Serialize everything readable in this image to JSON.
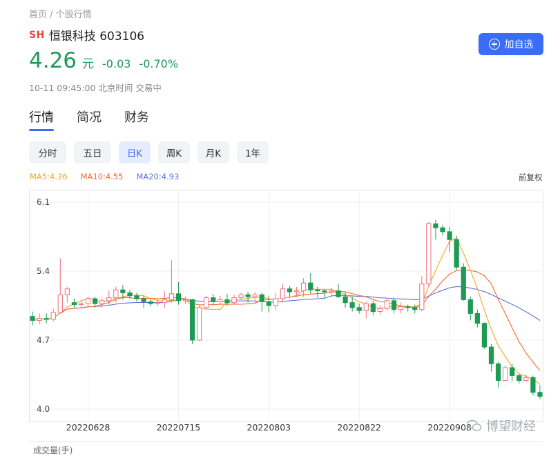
{
  "breadcrumb": {
    "home": "首页",
    "separator": "/",
    "current": "个股行情"
  },
  "stock": {
    "exchange": "SH",
    "name_code": "恒银科技 603106",
    "price": "4.26",
    "unit": "元",
    "change": "-0.03",
    "change_pct": "-0.70%",
    "time_status": "10-11 09:45:00 北京时间 交易中"
  },
  "follow_button": {
    "label": "加自选"
  },
  "tabs": [
    {
      "label": "行情"
    },
    {
      "label": "简况"
    },
    {
      "label": "财务"
    }
  ],
  "periods": [
    {
      "label": "分时"
    },
    {
      "label": "五日"
    },
    {
      "label": "日K"
    },
    {
      "label": "周K"
    },
    {
      "label": "月K"
    },
    {
      "label": "1年"
    }
  ],
  "ma_legend": {
    "ma5": "MA5:4.36",
    "ma10": "MA10:4.55",
    "ma20": "MA20:4.93"
  },
  "adjust_label": "前复权",
  "volume_label": "成交量(手)",
  "watermark": "博望财经",
  "colors": {
    "up": "#f26d7d",
    "down": "#1e9a52",
    "ma5": "#f5a623",
    "ma10": "#f06a2e",
    "ma20": "#5b72d8",
    "accent": "#3b6cf6"
  },
  "chart_data": {
    "type": "candlestick",
    "y_ticks": [
      "6.1",
      "5.4",
      "4.7",
      "4.0"
    ],
    "ylim": [
      4.0,
      6.1
    ],
    "x_labels": [
      "20220628",
      "20220715",
      "20220803",
      "20220822",
      "20220908"
    ],
    "ohlc": [
      [
        4.94,
        4.9,
        4.99,
        4.85
      ],
      [
        4.9,
        4.92,
        4.97,
        4.86
      ],
      [
        4.92,
        4.91,
        4.97,
        4.87
      ],
      [
        4.91,
        4.98,
        5.02,
        4.89
      ],
      [
        4.98,
        5.16,
        5.53,
        4.97
      ],
      [
        5.16,
        5.22,
        5.24,
        5.08
      ],
      [
        5.08,
        5.06,
        5.12,
        5.03
      ],
      [
        5.06,
        5.07,
        5.11,
        5.03
      ],
      [
        5.07,
        5.12,
        5.14,
        5.05
      ],
      [
        5.12,
        5.07,
        5.14,
        5.03
      ],
      [
        5.07,
        5.1,
        5.13,
        5.03
      ],
      [
        5.1,
        5.13,
        5.2,
        5.05
      ],
      [
        5.13,
        5.21,
        5.24,
        5.08
      ],
      [
        5.21,
        5.18,
        5.26,
        5.11
      ],
      [
        5.18,
        5.15,
        5.21,
        5.12
      ],
      [
        5.15,
        5.12,
        5.18,
        5.09
      ],
      [
        5.12,
        5.09,
        5.15,
        5.03
      ],
      [
        5.09,
        5.07,
        5.12,
        5.04
      ],
      [
        5.07,
        5.08,
        5.12,
        5.05
      ],
      [
        5.08,
        5.11,
        5.2,
        5.03
      ],
      [
        5.11,
        5.17,
        5.51,
        5.08
      ],
      [
        5.17,
        5.1,
        5.29,
        5.06
      ],
      [
        5.1,
        5.11,
        5.14,
        5.07
      ],
      [
        5.11,
        4.7,
        5.12,
        4.66
      ],
      [
        4.7,
        5.03,
        5.06,
        4.69
      ],
      [
        5.03,
        5.13,
        5.15,
        5.01
      ],
      [
        5.13,
        5.09,
        5.17,
        5.06
      ],
      [
        5.09,
        5.11,
        5.15,
        5.06
      ],
      [
        5.11,
        5.08,
        5.17,
        5.05
      ],
      [
        5.08,
        5.13,
        5.16,
        5.07
      ],
      [
        5.13,
        5.16,
        5.18,
        5.11
      ],
      [
        5.16,
        5.14,
        5.19,
        5.08
      ],
      [
        5.14,
        5.16,
        5.19,
        5.08
      ],
      [
        5.16,
        5.09,
        5.18,
        4.99
      ],
      [
        5.09,
        5.05,
        5.15,
        4.98
      ],
      [
        5.05,
        5.12,
        5.18,
        5.0
      ],
      [
        5.12,
        5.22,
        5.27,
        5.08
      ],
      [
        5.22,
        5.19,
        5.25,
        5.13
      ],
      [
        5.19,
        5.2,
        5.24,
        5.14
      ],
      [
        5.2,
        5.28,
        5.33,
        5.14
      ],
      [
        5.28,
        5.21,
        5.38,
        5.17
      ],
      [
        5.21,
        5.2,
        5.24,
        5.13
      ],
      [
        5.2,
        5.19,
        5.22,
        5.13
      ],
      [
        5.19,
        5.2,
        5.23,
        5.14
      ],
      [
        5.2,
        5.14,
        5.27,
        5.13
      ],
      [
        5.14,
        5.08,
        5.19,
        5.03
      ],
      [
        5.08,
        5.03,
        5.14,
        4.99
      ],
      [
        5.03,
        5.0,
        5.07,
        4.97
      ],
      [
        5.0,
        5.07,
        5.09,
        4.92
      ],
      [
        5.07,
        4.99,
        5.1,
        4.95
      ],
      [
        4.99,
        5.02,
        5.05,
        4.96
      ],
      [
        5.02,
        5.1,
        5.13,
        5.0
      ],
      [
        5.1,
        5.01,
        5.13,
        4.97
      ],
      [
        5.01,
        5.04,
        5.08,
        4.97
      ],
      [
        5.04,
        5.03,
        5.06,
        4.99
      ],
      [
        5.03,
        5.01,
        5.06,
        4.97
      ],
      [
        5.01,
        5.27,
        5.35,
        4.99
      ],
      [
        5.27,
        5.88,
        5.9,
        5.24
      ],
      [
        5.88,
        5.84,
        5.92,
        5.72
      ],
      [
        5.84,
        5.8,
        5.87,
        5.76
      ],
      [
        5.8,
        5.72,
        5.85,
        5.59
      ],
      [
        5.72,
        5.44,
        5.76,
        5.41
      ],
      [
        5.44,
        5.11,
        5.48,
        5.1
      ],
      [
        5.11,
        4.97,
        5.14,
        4.9
      ],
      [
        4.97,
        4.87,
        5.01,
        4.83
      ],
      [
        4.87,
        4.63,
        4.88,
        4.61
      ],
      [
        4.63,
        4.46,
        4.66,
        4.38
      ],
      [
        4.46,
        4.29,
        4.48,
        4.22
      ],
      [
        4.29,
        4.42,
        4.44,
        4.28
      ],
      [
        4.42,
        4.34,
        4.46,
        4.28
      ],
      [
        4.34,
        4.29,
        4.36,
        4.26
      ],
      [
        4.29,
        4.32,
        4.35,
        4.28
      ],
      [
        4.32,
        4.17,
        4.34,
        4.14
      ],
      [
        4.17,
        4.13,
        4.24,
        4.1
      ]
    ]
  }
}
